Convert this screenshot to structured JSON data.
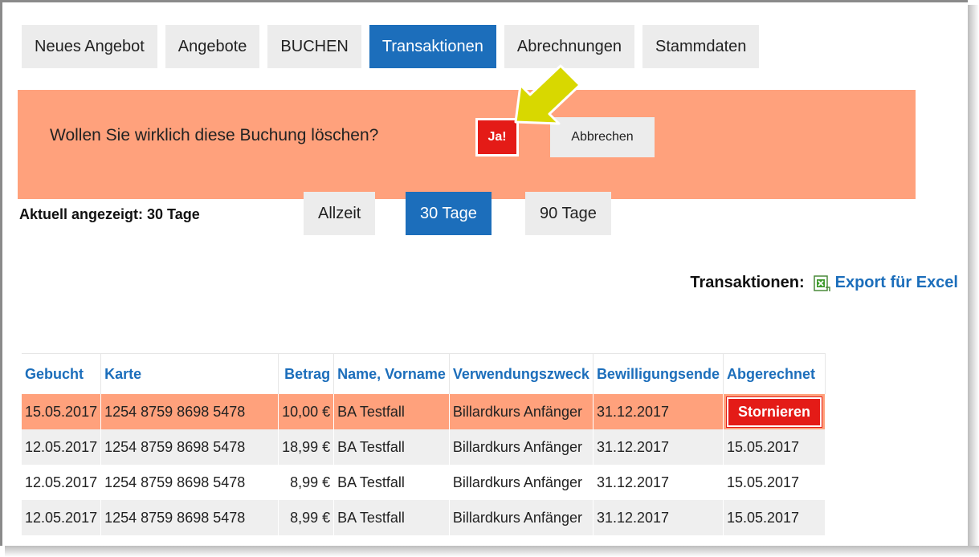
{
  "nav": {
    "tabs": [
      {
        "label": "Neues Angebot",
        "active": false
      },
      {
        "label": "Angebote",
        "active": false
      },
      {
        "label": "BUCHEN",
        "active": false
      },
      {
        "label": "Transaktionen",
        "active": true
      },
      {
        "label": "Abrechnungen",
        "active": false
      },
      {
        "label": "Stammdaten",
        "active": false
      }
    ]
  },
  "confirm": {
    "question": "Wollen Sie wirklich diese Buchung löschen?",
    "yes_label": "Ja!",
    "cancel_label": "Abbrechen"
  },
  "period": {
    "label": "Aktuell angezeigt: 30 Tage",
    "options": [
      {
        "label": "Allzeit",
        "active": false
      },
      {
        "label": "30 Tage",
        "active": true
      },
      {
        "label": "90 Tage",
        "active": false
      }
    ]
  },
  "export": {
    "label": "Transaktionen:",
    "link": "Export für Excel",
    "icon": "excel-icon"
  },
  "table": {
    "headers": [
      "Gebucht",
      "Karte",
      "Betrag",
      "Name, Vorname",
      "Verwendungszweck",
      "Bewilligungsende",
      "Abgerechnet"
    ],
    "storno_label": "Stornieren",
    "rows": [
      {
        "gebucht": "15.05.2017",
        "karte": "1254 8759 8698 5478",
        "betrag": "10,00 €",
        "name": "BA Testfall",
        "zweck": "Billardkurs Anfänger",
        "ende": "31.12.2017",
        "abgerechnet": "",
        "highlight": true
      },
      {
        "gebucht": "12.05.2017",
        "karte": "1254 8759 8698 5478",
        "betrag": "18,99 €",
        "name": "BA Testfall",
        "zweck": "Billardkurs Anfänger",
        "ende": "31.12.2017",
        "abgerechnet": "15.05.2017",
        "highlight": false
      },
      {
        "gebucht": "12.05.2017",
        "karte": "1254 8759 8698 5478",
        "betrag": "8,99 €",
        "name": "BA Testfall",
        "zweck": "Billardkurs Anfänger",
        "ende": "31.12.2017",
        "abgerechnet": "15.05.2017",
        "highlight": false
      },
      {
        "gebucht": "12.05.2017",
        "karte": "1254 8759 8698 5478",
        "betrag": "8,99 €",
        "name": "BA Testfall",
        "zweck": "Billardkurs Anfänger",
        "ende": "31.12.2017",
        "abgerechnet": "15.05.2017",
        "highlight": false
      }
    ]
  },
  "colors": {
    "accent": "#1c6ebb",
    "confirm_bg": "#ffa17c",
    "danger": "#e41b17",
    "arrow": "#d8d800"
  }
}
